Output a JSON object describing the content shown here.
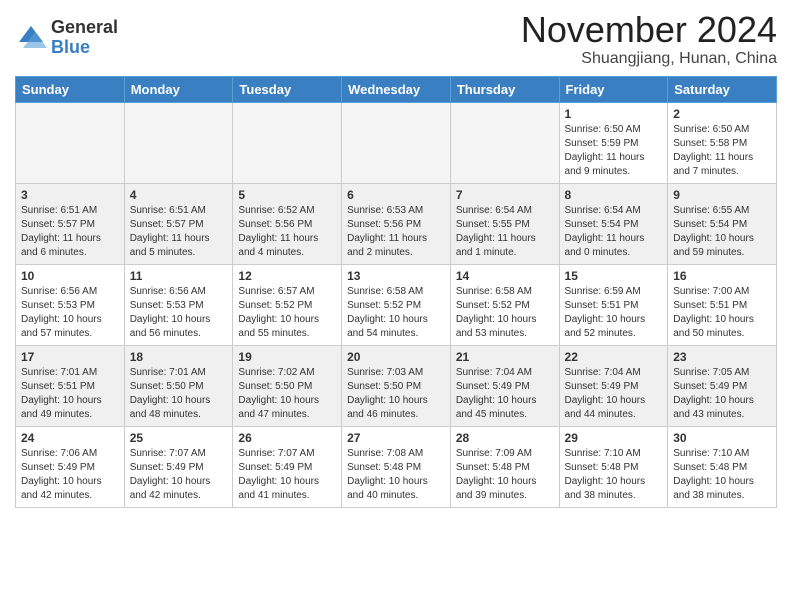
{
  "logo": {
    "general": "General",
    "blue": "Blue"
  },
  "header": {
    "month": "November 2024",
    "location": "Shuangjiang, Hunan, China"
  },
  "weekdays": [
    "Sunday",
    "Monday",
    "Tuesday",
    "Wednesday",
    "Thursday",
    "Friday",
    "Saturday"
  ],
  "weeks": [
    [
      {
        "day": "",
        "empty": true
      },
      {
        "day": "",
        "empty": true
      },
      {
        "day": "",
        "empty": true
      },
      {
        "day": "",
        "empty": true
      },
      {
        "day": "",
        "empty": true
      },
      {
        "day": "1",
        "sunrise": "Sunrise: 6:50 AM",
        "sunset": "Sunset: 5:59 PM",
        "daylight": "Daylight: 11 hours and 9 minutes."
      },
      {
        "day": "2",
        "sunrise": "Sunrise: 6:50 AM",
        "sunset": "Sunset: 5:58 PM",
        "daylight": "Daylight: 11 hours and 7 minutes."
      }
    ],
    [
      {
        "day": "3",
        "sunrise": "Sunrise: 6:51 AM",
        "sunset": "Sunset: 5:57 PM",
        "daylight": "Daylight: 11 hours and 6 minutes."
      },
      {
        "day": "4",
        "sunrise": "Sunrise: 6:51 AM",
        "sunset": "Sunset: 5:57 PM",
        "daylight": "Daylight: 11 hours and 5 minutes."
      },
      {
        "day": "5",
        "sunrise": "Sunrise: 6:52 AM",
        "sunset": "Sunset: 5:56 PM",
        "daylight": "Daylight: 11 hours and 4 minutes."
      },
      {
        "day": "6",
        "sunrise": "Sunrise: 6:53 AM",
        "sunset": "Sunset: 5:56 PM",
        "daylight": "Daylight: 11 hours and 2 minutes."
      },
      {
        "day": "7",
        "sunrise": "Sunrise: 6:54 AM",
        "sunset": "Sunset: 5:55 PM",
        "daylight": "Daylight: 11 hours and 1 minute."
      },
      {
        "day": "8",
        "sunrise": "Sunrise: 6:54 AM",
        "sunset": "Sunset: 5:54 PM",
        "daylight": "Daylight: 11 hours and 0 minutes."
      },
      {
        "day": "9",
        "sunrise": "Sunrise: 6:55 AM",
        "sunset": "Sunset: 5:54 PM",
        "daylight": "Daylight: 10 hours and 59 minutes."
      }
    ],
    [
      {
        "day": "10",
        "sunrise": "Sunrise: 6:56 AM",
        "sunset": "Sunset: 5:53 PM",
        "daylight": "Daylight: 10 hours and 57 minutes."
      },
      {
        "day": "11",
        "sunrise": "Sunrise: 6:56 AM",
        "sunset": "Sunset: 5:53 PM",
        "daylight": "Daylight: 10 hours and 56 minutes."
      },
      {
        "day": "12",
        "sunrise": "Sunrise: 6:57 AM",
        "sunset": "Sunset: 5:52 PM",
        "daylight": "Daylight: 10 hours and 55 minutes."
      },
      {
        "day": "13",
        "sunrise": "Sunrise: 6:58 AM",
        "sunset": "Sunset: 5:52 PM",
        "daylight": "Daylight: 10 hours and 54 minutes."
      },
      {
        "day": "14",
        "sunrise": "Sunrise: 6:58 AM",
        "sunset": "Sunset: 5:52 PM",
        "daylight": "Daylight: 10 hours and 53 minutes."
      },
      {
        "day": "15",
        "sunrise": "Sunrise: 6:59 AM",
        "sunset": "Sunset: 5:51 PM",
        "daylight": "Daylight: 10 hours and 52 minutes."
      },
      {
        "day": "16",
        "sunrise": "Sunrise: 7:00 AM",
        "sunset": "Sunset: 5:51 PM",
        "daylight": "Daylight: 10 hours and 50 minutes."
      }
    ],
    [
      {
        "day": "17",
        "sunrise": "Sunrise: 7:01 AM",
        "sunset": "Sunset: 5:51 PM",
        "daylight": "Daylight: 10 hours and 49 minutes."
      },
      {
        "day": "18",
        "sunrise": "Sunrise: 7:01 AM",
        "sunset": "Sunset: 5:50 PM",
        "daylight": "Daylight: 10 hours and 48 minutes."
      },
      {
        "day": "19",
        "sunrise": "Sunrise: 7:02 AM",
        "sunset": "Sunset: 5:50 PM",
        "daylight": "Daylight: 10 hours and 47 minutes."
      },
      {
        "day": "20",
        "sunrise": "Sunrise: 7:03 AM",
        "sunset": "Sunset: 5:50 PM",
        "daylight": "Daylight: 10 hours and 46 minutes."
      },
      {
        "day": "21",
        "sunrise": "Sunrise: 7:04 AM",
        "sunset": "Sunset: 5:49 PM",
        "daylight": "Daylight: 10 hours and 45 minutes."
      },
      {
        "day": "22",
        "sunrise": "Sunrise: 7:04 AM",
        "sunset": "Sunset: 5:49 PM",
        "daylight": "Daylight: 10 hours and 44 minutes."
      },
      {
        "day": "23",
        "sunrise": "Sunrise: 7:05 AM",
        "sunset": "Sunset: 5:49 PM",
        "daylight": "Daylight: 10 hours and 43 minutes."
      }
    ],
    [
      {
        "day": "24",
        "sunrise": "Sunrise: 7:06 AM",
        "sunset": "Sunset: 5:49 PM",
        "daylight": "Daylight: 10 hours and 42 minutes."
      },
      {
        "day": "25",
        "sunrise": "Sunrise: 7:07 AM",
        "sunset": "Sunset: 5:49 PM",
        "daylight": "Daylight: 10 hours and 42 minutes."
      },
      {
        "day": "26",
        "sunrise": "Sunrise: 7:07 AM",
        "sunset": "Sunset: 5:49 PM",
        "daylight": "Daylight: 10 hours and 41 minutes."
      },
      {
        "day": "27",
        "sunrise": "Sunrise: 7:08 AM",
        "sunset": "Sunset: 5:48 PM",
        "daylight": "Daylight: 10 hours and 40 minutes."
      },
      {
        "day": "28",
        "sunrise": "Sunrise: 7:09 AM",
        "sunset": "Sunset: 5:48 PM",
        "daylight": "Daylight: 10 hours and 39 minutes."
      },
      {
        "day": "29",
        "sunrise": "Sunrise: 7:10 AM",
        "sunset": "Sunset: 5:48 PM",
        "daylight": "Daylight: 10 hours and 38 minutes."
      },
      {
        "day": "30",
        "sunrise": "Sunrise: 7:10 AM",
        "sunset": "Sunset: 5:48 PM",
        "daylight": "Daylight: 10 hours and 38 minutes."
      }
    ]
  ]
}
